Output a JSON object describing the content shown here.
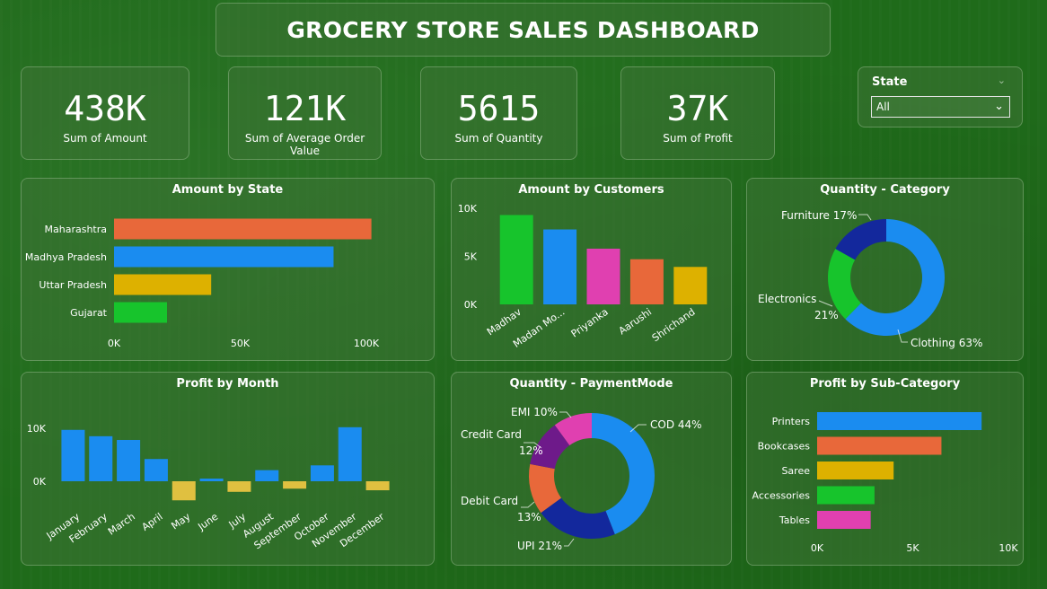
{
  "title": "GROCERY STORE SALES DASHBOARD",
  "kpis": [
    {
      "value": "438K",
      "label": "Sum of Amount"
    },
    {
      "value": "121K",
      "label": "Sum of Average Order Value"
    },
    {
      "value": "5615",
      "label": "Sum of Quantity"
    },
    {
      "value": "37K",
      "label": "Sum of Profit"
    }
  ],
  "slicer": {
    "title": "State",
    "selected": "All",
    "icon": "chevron-down-icon"
  },
  "chart_data": [
    {
      "id": "amount-by-state",
      "type": "bar",
      "orientation": "horizontal",
      "title": "Amount by State",
      "categories": [
        "Maharashtra",
        "Madhya Pradesh",
        "Uttar Pradesh",
        "Gujarat"
      ],
      "values": [
        102000,
        87000,
        38500,
        21000
      ],
      "colors": [
        "#e8683a",
        "#1a8cf0",
        "#ddb100",
        "#17c42c"
      ],
      "xlim": [
        0,
        100000
      ],
      "xticks": [
        {
          "v": 0,
          "label": "0K"
        },
        {
          "v": 50000,
          "label": "50K"
        },
        {
          "v": 100000,
          "label": "100K"
        }
      ],
      "grid": false
    },
    {
      "id": "amount-by-customers",
      "type": "bar",
      "orientation": "vertical",
      "title": "Amount by Customers",
      "categories": [
        "Madhav",
        "Madan Mo...",
        "Priyanka",
        "Aarushi",
        "Shrichand"
      ],
      "values": [
        9300,
        7800,
        5800,
        4700,
        3900
      ],
      "colors": [
        "#17c42c",
        "#1a8cf0",
        "#e040b0",
        "#e8683a",
        "#ddb100"
      ],
      "ylim": [
        0,
        10000
      ],
      "yticks": [
        {
          "v": 0,
          "label": "0K"
        },
        {
          "v": 5000,
          "label": "5K"
        },
        {
          "v": 10000,
          "label": "10K"
        }
      ],
      "grid": false
    },
    {
      "id": "quantity-category",
      "type": "pie",
      "donut": true,
      "title": "Quantity - Category",
      "slices": [
        {
          "label": "Clothing",
          "pct": "63%",
          "value": 63,
          "color": "#1a8cf0"
        },
        {
          "label": "Electronics",
          "pct": "21%",
          "value": 21,
          "color": "#17c42c"
        },
        {
          "label": "Furniture",
          "pct": "17%",
          "value": 17,
          "color": "#13289c"
        }
      ]
    },
    {
      "id": "profit-by-month",
      "type": "bar",
      "orientation": "vertical",
      "title": "Profit by Month",
      "categories": [
        "January",
        "February",
        "March",
        "April",
        "May",
        "June",
        "July",
        "August",
        "September",
        "October",
        "November",
        "December"
      ],
      "values": [
        9700,
        8500,
        7800,
        4200,
        -3600,
        500,
        -2000,
        2100,
        -1400,
        3000,
        10200,
        -1700
      ],
      "positive_color": "#1a8cf0",
      "negative_color": "#e0c040",
      "ylim": [
        -4500,
        12000
      ],
      "yticks": [
        {
          "v": 0,
          "label": "0K"
        },
        {
          "v": 10000,
          "label": "10K"
        }
      ],
      "grid": false
    },
    {
      "id": "quantity-paymentmode",
      "type": "pie",
      "donut": true,
      "title": "Quantity - PaymentMode",
      "slices": [
        {
          "label": "COD",
          "pct": "44%",
          "value": 44,
          "color": "#1a8cf0"
        },
        {
          "label": "UPI",
          "pct": "21%",
          "value": 21,
          "color": "#13289c"
        },
        {
          "label": "Debit Card",
          "pct": "13%",
          "value": 13,
          "color": "#e8683a"
        },
        {
          "label": "Credit Card",
          "pct": "12%",
          "value": 12,
          "color": "#6e1a8a"
        },
        {
          "label": "EMI",
          "pct": "10%",
          "value": 10,
          "color": "#e040b0"
        }
      ]
    },
    {
      "id": "profit-by-sub-category",
      "type": "bar",
      "orientation": "horizontal",
      "title": "Profit by Sub-Category",
      "categories": [
        "Printers",
        "Bookcases",
        "Saree",
        "Accessories",
        "Tables"
      ],
      "values": [
        8600,
        6500,
        4000,
        3000,
        2800
      ],
      "colors": [
        "#1a8cf0",
        "#e8683a",
        "#ddb100",
        "#17c42c",
        "#e040b0"
      ],
      "xlim": [
        0,
        10000
      ],
      "xticks": [
        {
          "v": 0,
          "label": "0K"
        },
        {
          "v": 5000,
          "label": "5K"
        },
        {
          "v": 10000,
          "label": "10K"
        }
      ],
      "grid": false
    }
  ]
}
